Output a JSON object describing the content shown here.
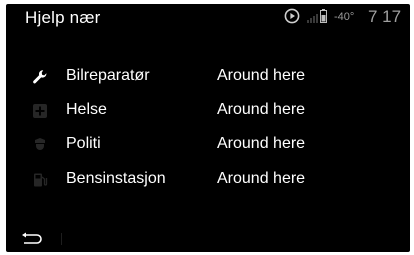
{
  "header": {
    "title": "Hjelp nær",
    "temperature": "-40°",
    "clock": "7 17"
  },
  "items": [
    {
      "name": "Bilreparatør",
      "distance": "Around here",
      "icon": "wrench-icon"
    },
    {
      "name": "Helse",
      "distance": "Around here",
      "icon": "medical-cross-icon"
    },
    {
      "name": "Politi",
      "distance": "Around here",
      "icon": "police-badge-icon"
    },
    {
      "name": "Bensinstasjon",
      "distance": "Around here",
      "icon": "fuel-pump-icon"
    }
  ],
  "footer": {
    "back_icon": "back-arrow-icon"
  },
  "colors": {
    "background": "#000000",
    "text": "#ffffff",
    "dim_icon": "#2a2a2a",
    "status_text": "#9a9a9a"
  }
}
